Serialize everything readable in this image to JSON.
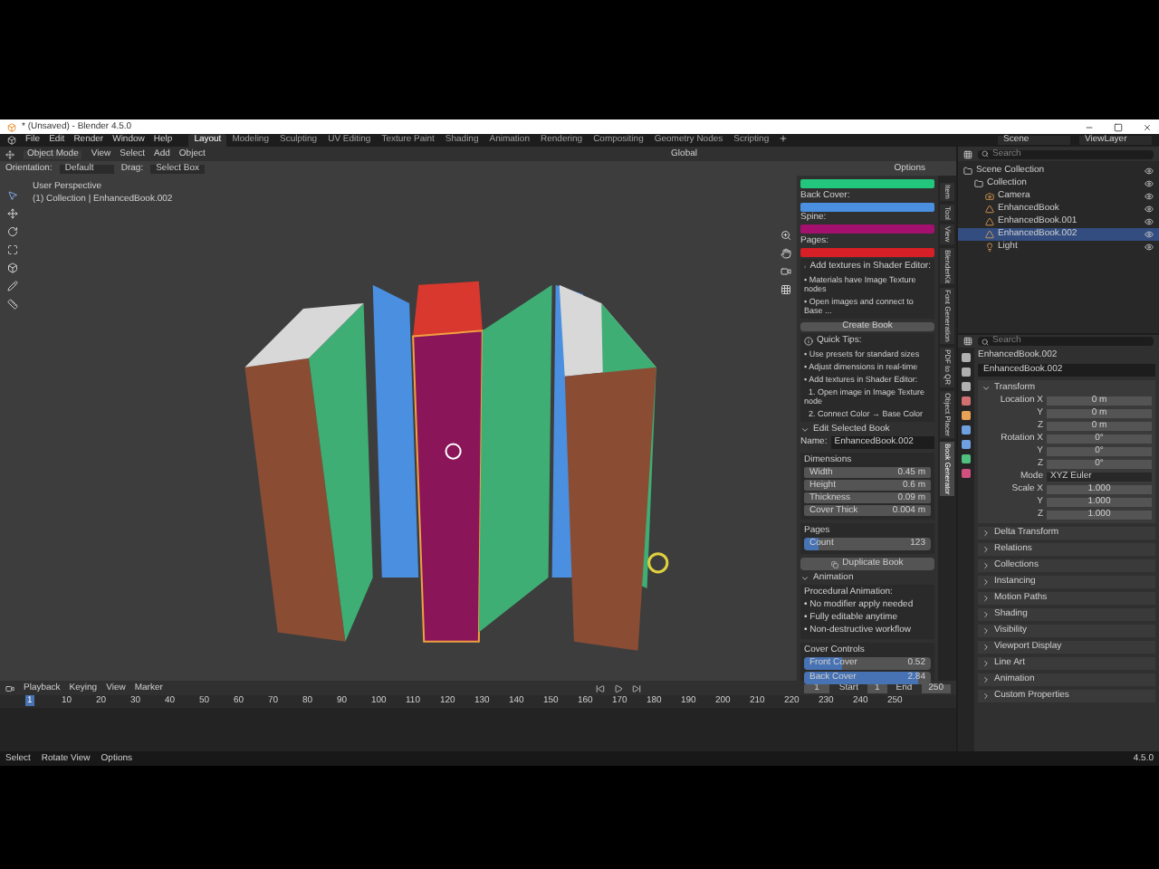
{
  "window": {
    "title": "* (Unsaved) - Blender 4.5.0"
  },
  "menu": [
    "File",
    "Edit",
    "Render",
    "Window",
    "Help"
  ],
  "workspaces": [
    {
      "label": "Layout",
      "selected": true
    },
    {
      "label": "Modeling",
      "selected": false
    },
    {
      "label": "Sculpting",
      "selected": false
    },
    {
      "label": "UV Editing",
      "selected": false
    },
    {
      "label": "Texture Paint",
      "selected": false
    },
    {
      "label": "Shading",
      "selected": false
    },
    {
      "label": "Animation",
      "selected": false
    },
    {
      "label": "Rendering",
      "selected": false
    },
    {
      "label": "Compositing",
      "selected": false
    },
    {
      "label": "Geometry Nodes",
      "selected": false
    },
    {
      "label": "Scripting",
      "selected": false
    }
  ],
  "scene": "Scene",
  "view_layer": "ViewLayer",
  "viewport": {
    "mode": "Object Mode",
    "menus": [
      "View",
      "Select",
      "Add",
      "Object"
    ],
    "transform": "Global",
    "orientation_label": "Orientation:",
    "orientation": "Default",
    "drag_label": "Drag:",
    "drag": "Select Box",
    "options": "Options",
    "overlay_title": "User Perspective",
    "overlay_subtitle": "(1) Collection | EnhancedBook.002"
  },
  "sidebar": {
    "colors": [
      {
        "color": "#22c67c"
      },
      {
        "label": "Back Cover:",
        "color": "#4a8fe0"
      },
      {
        "label": "Spine:",
        "color": "#a3106e"
      },
      {
        "label": "Pages:",
        "color": "#d61f26"
      }
    ],
    "texture_note": {
      "title": "Add textures in Shader Editor:",
      "lines": [
        "• Materials have Image Texture nodes",
        "• Open images and connect to Base ..."
      ]
    },
    "create_button": "Create Book",
    "tips": {
      "title": "Quick Tips:",
      "lines": [
        "• Use presets for standard sizes",
        "• Adjust dimensions in real-time",
        "• Add textures in Shader Editor:",
        "  1. Open image in Image Texture node",
        "  2. Connect Color → Base Color"
      ]
    },
    "edit": {
      "title": "Edit Selected Book",
      "expanded": true,
      "name_label": "Name:",
      "name": "EnhancedBook.002",
      "dimensions": {
        "title": "Dimensions",
        "fields": [
          {
            "label": "Width",
            "value": "0.45 m"
          },
          {
            "label": "Height",
            "value": "0.6 m"
          },
          {
            "label": "Thickness",
            "value": "0.09 m"
          },
          {
            "label": "Cover Thick",
            "value": "0.004 m"
          }
        ]
      },
      "pages": {
        "title": "Pages",
        "label": "Count",
        "value": "123",
        "level": 0.12
      },
      "duplicate_button": "Duplicate Book"
    },
    "animation": {
      "title": "Animation",
      "expanded": true,
      "heading": "Procedural Animation:",
      "lines": [
        "• No modifier apply needed",
        "• Fully editable anytime",
        "• Non-destructive workflow"
      ],
      "cover_title": "Cover Controls",
      "sliders": [
        {
          "label": "Front Cover",
          "value": "0.52",
          "level": 0.3
        },
        {
          "label": "Back Cover",
          "value": "2.84",
          "level": 0.9
        }
      ]
    }
  },
  "sidebar_tabs": [
    {
      "label": "Item",
      "selected": false
    },
    {
      "label": "Tool",
      "selected": false
    },
    {
      "label": "View",
      "selected": false
    },
    {
      "label": "BlenderKit",
      "selected": false
    },
    {
      "label": "Font Generation",
      "selected": false
    },
    {
      "label": "PDF to QR",
      "selected": false
    },
    {
      "label": "Object Placer",
      "selected": false
    },
    {
      "label": "Book Generator",
      "selected": true
    }
  ],
  "outliner": {
    "search_placeholder": "Search",
    "tree": [
      {
        "label": "Scene Collection",
        "kind": "collection",
        "selected": false,
        "children": [
          {
            "label": "Collection",
            "kind": "collection",
            "selected": false,
            "children": [
              {
                "label": "Camera",
                "kind": "camera",
                "selected": false
              },
              {
                "label": "EnhancedBook",
                "kind": "mesh",
                "selected": false
              },
              {
                "label": "EnhancedBook.001",
                "kind": "mesh",
                "selected": false
              },
              {
                "label": "EnhancedBook.002",
                "kind": "mesh",
                "selected": true
              },
              {
                "label": "Light",
                "kind": "light",
                "selected": false
              }
            ]
          }
        ]
      }
    ]
  },
  "properties": {
    "search_placeholder": "Search",
    "object_name": "EnhancedBook.002",
    "data_name": "EnhancedBook.002",
    "transform": {
      "title": "Transform",
      "expanded": true,
      "rows": [
        {
          "kind": "field",
          "label": "Location X",
          "value": "0 m"
        },
        {
          "kind": "field",
          "label": "Y",
          "value": "0 m"
        },
        {
          "kind": "field",
          "label": "Z",
          "value": "0 m"
        },
        {
          "kind": "field",
          "label": "Rotation X",
          "value": "0°"
        },
        {
          "kind": "field",
          "label": "Y",
          "value": "0°"
        },
        {
          "kind": "field",
          "label": "Z",
          "value": "0°"
        },
        {
          "kind": "dropdown",
          "label": "Mode",
          "value": "XYZ Euler"
        },
        {
          "kind": "field",
          "label": "Scale X",
          "value": "1.000"
        },
        {
          "kind": "field",
          "label": "Y",
          "value": "1.000"
        },
        {
          "kind": "field",
          "label": "Z",
          "value": "1.000"
        }
      ]
    },
    "panels": [
      {
        "title": "Delta Transform",
        "expanded": false
      },
      {
        "title": "Relations",
        "expanded": false
      },
      {
        "title": "Collections",
        "expanded": false
      },
      {
        "title": "Instancing",
        "expanded": false
      },
      {
        "title": "Motion Paths",
        "expanded": false
      },
      {
        "title": "Shading",
        "expanded": false
      },
      {
        "title": "Visibility",
        "expanded": false
      },
      {
        "title": "Viewport Display",
        "expanded": false
      },
      {
        "title": "Line Art",
        "expanded": false
      },
      {
        "title": "Animation",
        "expanded": false
      },
      {
        "title": "Custom Properties",
        "expanded": false
      }
    ]
  },
  "timeline": {
    "menus": [
      "Playback",
      "Keying",
      "View",
      "Marker"
    ],
    "frame": "1",
    "start_label": "Start",
    "start": "1",
    "end_label": "End",
    "end": "250",
    "ruler": [
      {
        "label": "1",
        "selected": true
      },
      {
        "label": "10",
        "selected": false
      },
      {
        "label": "20",
        "selected": false
      },
      {
        "label": "30",
        "selected": false
      },
      {
        "label": "40",
        "selected": false
      },
      {
        "label": "50",
        "selected": false
      },
      {
        "label": "60",
        "selected": false
      },
      {
        "label": "70",
        "selected": false
      },
      {
        "label": "80",
        "selected": false
      },
      {
        "label": "90",
        "selected": false
      },
      {
        "label": "100",
        "selected": false
      },
      {
        "label": "110",
        "selected": false
      },
      {
        "label": "120",
        "selected": false
      },
      {
        "label": "130",
        "selected": false
      },
      {
        "label": "140",
        "selected": false
      },
      {
        "label": "150",
        "selected": false
      },
      {
        "label": "160",
        "selected": false
      },
      {
        "label": "170",
        "selected": false
      },
      {
        "label": "180",
        "selected": false
      },
      {
        "label": "190",
        "selected": false
      },
      {
        "label": "200",
        "selected": false
      },
      {
        "label": "210",
        "selected": false
      },
      {
        "label": "220",
        "selected": false
      },
      {
        "label": "230",
        "selected": false
      },
      {
        "label": "240",
        "selected": false
      },
      {
        "label": "250",
        "selected": false
      }
    ]
  },
  "status": {
    "items": [
      "Select",
      "Rotate View",
      "Options"
    ],
    "version": "4.5.0"
  }
}
